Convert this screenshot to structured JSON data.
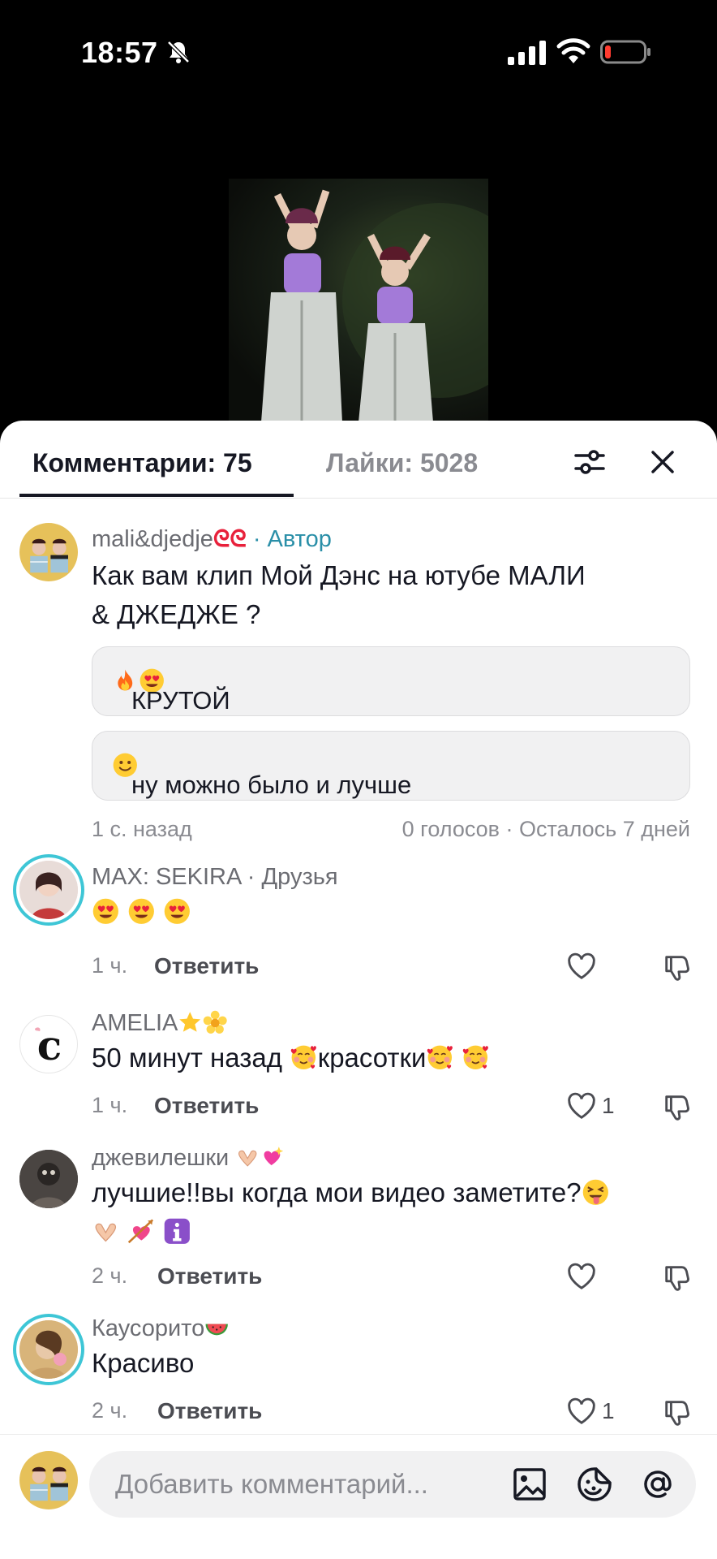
{
  "status_bar": {
    "time": "18:57"
  },
  "tabs": {
    "comments": "Комментарии: 75",
    "likes": "Лайки: 5028"
  },
  "comments": [
    {
      "username": "mali&djedje",
      "tag": "· Автор",
      "text_line1": "Как вам клип Мой Дэнс на ютубе МАЛИ",
      "text_line2": "& ДЖЕДЖЕ ?",
      "poll": {
        "options": [
          "КРУТОЙ",
          "ну можно было и лучше"
        ],
        "time": "1 с. назад",
        "votes": "0 голосов · Осталось 7 дней"
      }
    },
    {
      "username": "MAX: SEKIRA · Друзья",
      "time": "1 ч.",
      "reply": "Ответить"
    },
    {
      "username": "AMELIA",
      "text": "50 минут назад",
      "text2": "красотки",
      "time": "1 ч.",
      "reply": "Ответить",
      "likes": "1"
    },
    {
      "username": "джевилешки",
      "text": "лучшие!!вы когда мои видео заметите?",
      "time": "2 ч.",
      "reply": "Ответить"
    },
    {
      "username": "Каусорито",
      "text": "Красиво",
      "time": "2 ч.",
      "reply": "Ответить",
      "likes": "1"
    }
  ],
  "composer": {
    "placeholder": "Добавить комментарий..."
  }
}
